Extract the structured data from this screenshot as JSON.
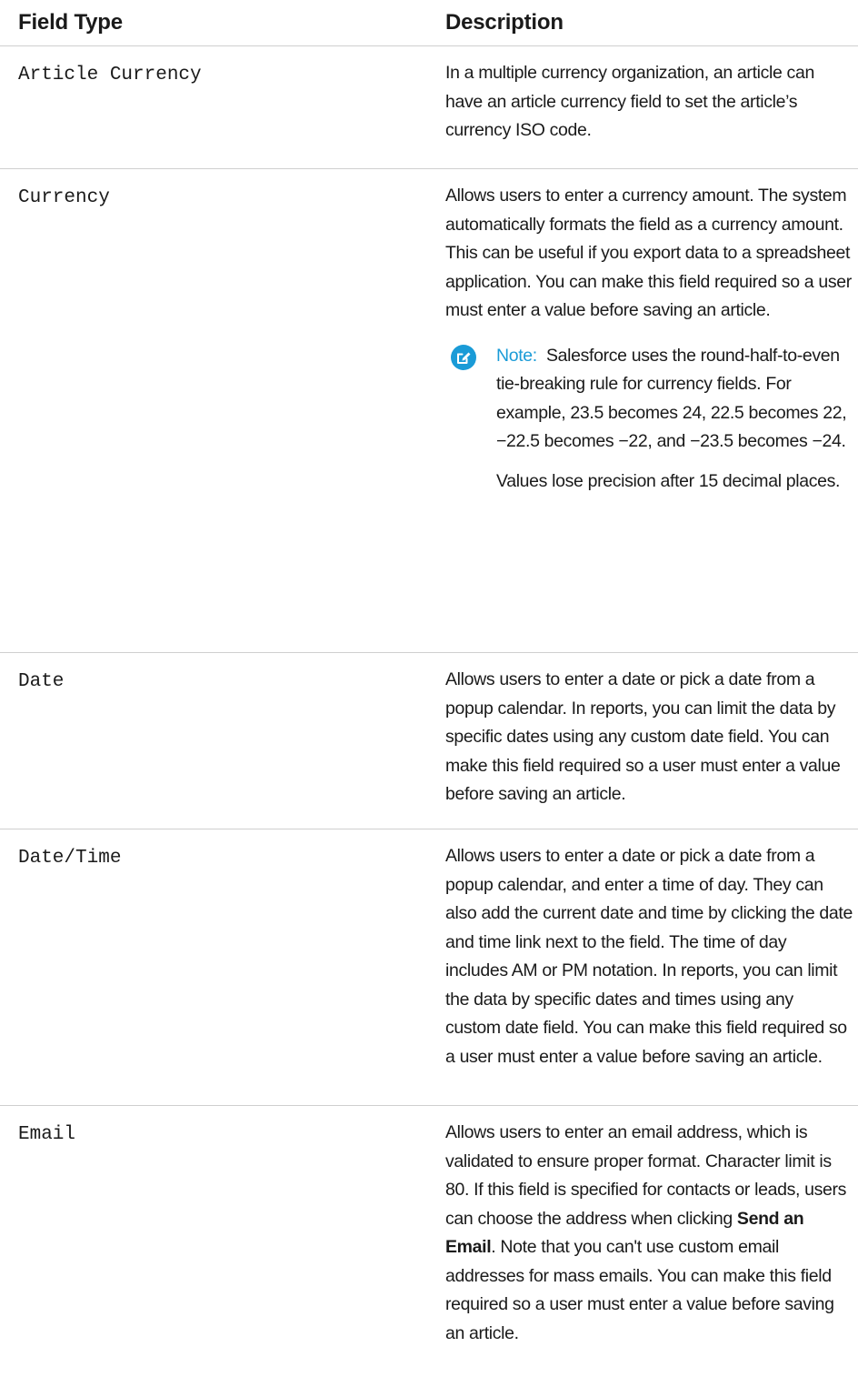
{
  "table": {
    "headers": {
      "field_type": "Field Type",
      "description": "Description"
    },
    "rows": [
      {
        "field": "Article Currency",
        "description": "In a multiple currency organization, an article can have an article currency field to set the article’s currency ISO code."
      },
      {
        "field": "Currency",
        "description": "Allows users to enter a currency amount. The system automatically formats the field as a currency amount. This can be useful if you export data to a spreadsheet application. You can make this field required so a user must enter a value before saving an article.",
        "note": {
          "label": "Note:",
          "text": "Salesforce uses the round-half-to-even tie-breaking rule for currency fields. For example, 23.5 becomes 24, 22.5 becomes 22, −22.5 becomes −22, and −23.5 becomes −24.",
          "text2": "Values lose precision after 15 decimal places.",
          "icon": "note-edit-icon",
          "color": "#1a9bd7"
        }
      },
      {
        "field": "Date",
        "description": "Allows users to enter a date or pick a date from a popup calendar. In reports, you can limit the data by specific dates using any custom date field. You can make this field required so a user must enter a value before saving an article."
      },
      {
        "field": "Date/Time",
        "description": "Allows users to enter a date or pick a date from a popup calendar, and enter a time of day. They can also add the current date and time by clicking the date and time link next to the field. The time of day includes AM or PM notation. In reports, you can limit the data by specific dates and times using any custom date field. You can make this field required so a user must enter a value before saving an article."
      },
      {
        "field": "Email",
        "description_pre": "Allows users to enter an email address, which is validated to ensure proper format. Character limit is 80. If this field is specified for contacts or leads, users can choose the address when clicking ",
        "description_bold": "Send an Email",
        "description_post": ". Note that you can't use custom email addresses for mass emails. You can make this field required so a user must enter a value before saving an article."
      }
    ]
  }
}
